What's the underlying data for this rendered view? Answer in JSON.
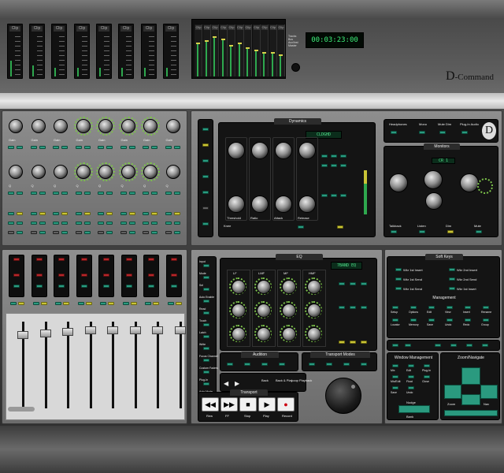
{
  "app": {
    "brand_letter": "D",
    "brand_rest": "-Command"
  },
  "meter_bridge": {
    "clip_label": "Clip",
    "channel_levels": [
      0.35,
      0.25,
      0.2,
      0.2,
      0.2,
      0.2,
      0.2,
      0.2
    ],
    "stereo_levels": [
      0.7,
      0.75,
      0.85,
      0.8,
      0.65,
      0.7,
      0.6,
      0.55,
      0.5,
      0.5,
      0.45
    ],
    "timecode": "00:03:23:00",
    "legend": [
      "Tracks",
      "Bus",
      "Aux/Inst",
      "Master"
    ]
  },
  "channel_strips": {
    "knob_labels": [
      "Gain",
      "Freq",
      "Q",
      "Gain"
    ],
    "row_labels": [
      "Clip Pre Sel",
      "Mute Solo",
      "Rec Input"
    ]
  },
  "dynamics": {
    "title": "Dynamics",
    "display": "CLDGHD",
    "knob_labels": [
      "Threshold",
      "Ratio",
      "Attack",
      "Release"
    ],
    "side_labels": [
      "Comp",
      "Gate",
      "Key"
    ],
    "bottom_labels": [
      "Knee",
      "Gain",
      "Bypass"
    ]
  },
  "monitor": {
    "header_buttons": [
      "Headphones",
      "Mono",
      "Mute Dim",
      "Plug-In Audio"
    ],
    "title": "Monitors",
    "display": "CR 1",
    "knob_labels": [
      "Input",
      "Output",
      "Studio",
      "Phones"
    ],
    "bottom_labels": [
      "Talkback",
      "Listen",
      "Dim",
      "Mute"
    ]
  },
  "eq": {
    "title": "EQ",
    "display": "7BAND EQ",
    "knob_labels": [
      "Freq",
      "Gain",
      "Q"
    ],
    "band_labels": [
      "LF",
      "LMF",
      "MF",
      "HMF"
    ],
    "bottom_labels": [
      "In/Out",
      "Bypass",
      "Copy"
    ]
  },
  "soft_keys": {
    "title": "Soft Keys",
    "items": [
      "Wkr 1st Insert",
      "Wkr 2nd Insert",
      "Wkr 1st Send",
      "Wkr 2nd Send",
      "Wkr 1st Send",
      "Wkr 1st Insert"
    ],
    "management": "Management",
    "grid": [
      "Setup",
      "Options",
      "Edit",
      "View",
      "Insert",
      "Rename",
      "Locator",
      "Memory",
      "Save",
      "Undo",
      "Redo",
      "Group"
    ]
  },
  "left_nav": {
    "labels": [
      "Input",
      "Mode",
      "Sel",
      "Auto Enable",
      "Read",
      "Touch",
      "Latch",
      "Write",
      "Focus Channel",
      "Custom Faders",
      "Plug-In",
      "Auto Mode",
      "Flip"
    ]
  },
  "audition": {
    "title": "Audition",
    "buttons": [
      "Audition",
      "Pre-Roll",
      "Post-Roll",
      "Back",
      "Back & Play",
      "Loop Playback"
    ]
  },
  "transport_modes": {
    "title": "Transport Modes",
    "buttons": [
      "Shuttle",
      "Scrub",
      "Loop Record",
      "Quick Punch"
    ]
  },
  "transport": {
    "title": "Transport",
    "buttons": [
      {
        "icon": "rewind",
        "glyph": "◀◀",
        "label": "Rew"
      },
      {
        "icon": "fast-forward",
        "glyph": "▶▶",
        "label": "FF"
      },
      {
        "icon": "stop",
        "glyph": "■",
        "label": "Stop"
      },
      {
        "icon": "play",
        "glyph": "▶",
        "label": "Play"
      },
      {
        "icon": "record",
        "glyph": "●",
        "label": "Record"
      }
    ],
    "online_label": "Online"
  },
  "window_management": {
    "title": "Window Management",
    "buttons": [
      "Mix",
      "Edit",
      "Plug-In",
      "Mix/Edit",
      "Float",
      "Close",
      "Save",
      "Undo"
    ]
  },
  "zoom_navigate": {
    "title": "Zoom/Navigate",
    "labels": [
      "Up",
      "Down",
      "Left",
      "Right",
      "Zoom",
      "Nav"
    ]
  },
  "nudge": {
    "title": "Nudge",
    "bank_label": "Bank"
  },
  "colors": {
    "meter_green": "#2ea84e",
    "button_teal": "#2a9a7f",
    "timecode_green": "#3ef07a",
    "accent_yellow": "#c9c436",
    "record_red": "#b5262a"
  }
}
